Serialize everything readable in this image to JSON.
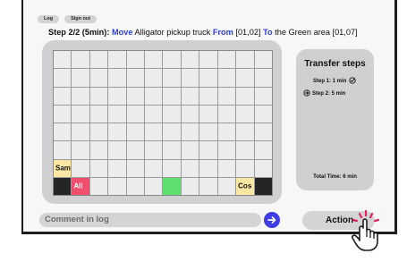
{
  "top_buttons": {
    "log": "Log",
    "sign_out": "Sign out"
  },
  "header": {
    "step": "Step 2/2 (5min):",
    "move_kw": "Move",
    "vehicle": "Alligator pickup truck",
    "from_kw": "From",
    "from_loc": "[01,02]",
    "to_kw": "To",
    "to_loc": "the Green area [01,07]"
  },
  "grid": {
    "rows": 8,
    "cols": 12,
    "cells": [
      {
        "row": 7,
        "col": 1,
        "color": "yellow",
        "label": "Sam"
      },
      {
        "row": 8,
        "col": 1,
        "color": "dark",
        "label": ""
      },
      {
        "row": 8,
        "col": 2,
        "color": "red",
        "label": "All"
      },
      {
        "row": 8,
        "col": 7,
        "color": "green",
        "label": ""
      },
      {
        "row": 8,
        "col": 11,
        "color": "yellow",
        "label": "Cos"
      },
      {
        "row": 8,
        "col": 12,
        "color": "dark",
        "label": ""
      }
    ]
  },
  "steps_panel": {
    "title": "Transfer steps",
    "step1": "Step 1: 1 min",
    "step2": "Step 2: 5 min",
    "total": "Total Time: 6 min"
  },
  "comment": {
    "placeholder": "Comment in log"
  },
  "action": {
    "label": "Action"
  },
  "icons": {
    "step1": "check-circle-icon",
    "step2": "arrow-right-circle-icon",
    "send": "arrow-right-icon",
    "cursor": "pointer-hand-icon"
  },
  "colors": {
    "highlight": "#2d3ed9",
    "send_button": "#3f3ee6",
    "red_cell": "#ef4f6c",
    "green_cell": "#5ee06e",
    "yellow_cell": "#fbe7a3",
    "dark_cell": "#252527"
  }
}
